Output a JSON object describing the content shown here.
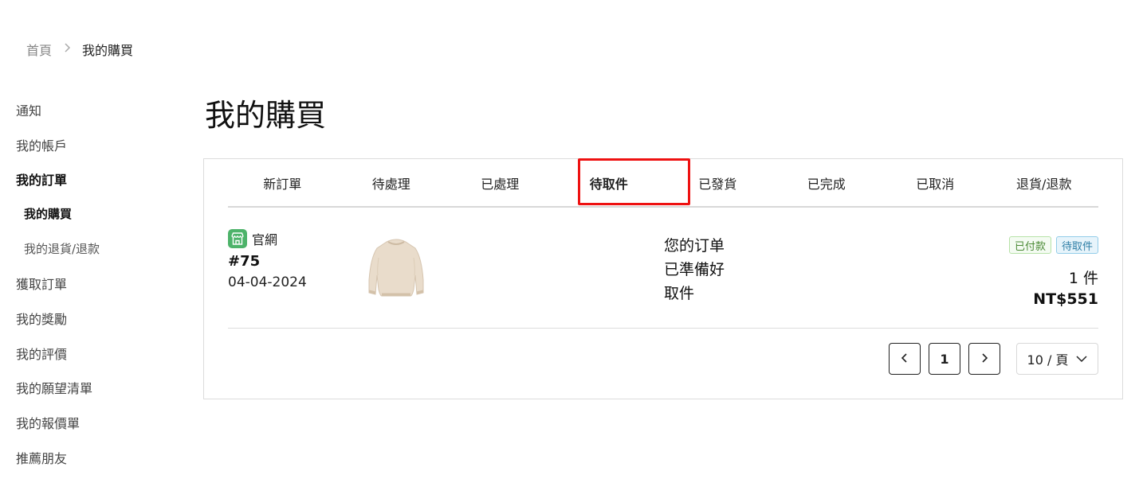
{
  "breadcrumb": {
    "home": "首頁",
    "current": "我的購買"
  },
  "sidebar": {
    "items": [
      {
        "label": "通知"
      },
      {
        "label": "我的帳戶"
      },
      {
        "label": "我的訂單"
      },
      {
        "label": "我的購買"
      },
      {
        "label": "我的退貨/退款"
      },
      {
        "label": "獲取訂單"
      },
      {
        "label": "我的獎勵"
      },
      {
        "label": "我的評價"
      },
      {
        "label": "我的願望清單"
      },
      {
        "label": "我的報價單"
      },
      {
        "label": "推薦朋友"
      }
    ]
  },
  "page": {
    "title": "我的購買"
  },
  "tabs": [
    {
      "label": "新訂單"
    },
    {
      "label": "待處理"
    },
    {
      "label": "已處理"
    },
    {
      "label": "待取件"
    },
    {
      "label": "已發貨"
    },
    {
      "label": "已完成"
    },
    {
      "label": "已取消"
    },
    {
      "label": "退貨/退款"
    }
  ],
  "order": {
    "store": "官網",
    "number": "#75",
    "date": "04-04-2024",
    "status_lines": [
      "您的订单",
      "已準備好",
      "取件"
    ],
    "badges": {
      "paid": "已付款",
      "pickup": "待取件"
    },
    "quantity": "1 件",
    "price": "NT$551"
  },
  "pagination": {
    "current_page": "1",
    "page_size": "10 / 頁"
  },
  "colors": {
    "highlight": "#ee1111",
    "store_icon": "#4db36a",
    "badge_paid": "#4a8a35",
    "badge_pickup": "#2e7ea6"
  },
  "icons": {
    "store": "store-icon",
    "prev": "chevron-left-icon",
    "next": "chevron-right-icon",
    "dropdown": "chevron-down-icon",
    "breadcrumb_sep": "chevron-right-icon"
  }
}
